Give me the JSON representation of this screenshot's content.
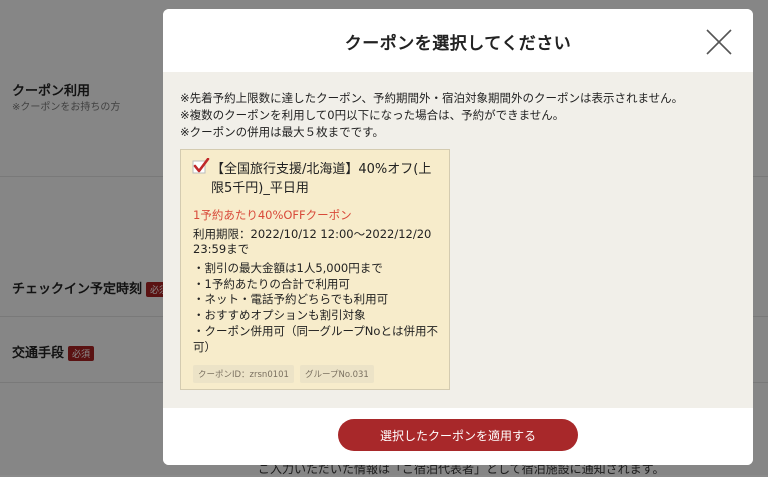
{
  "background": {
    "coupon_label": "クーポン利用",
    "coupon_sub": "※クーポンをお持ちの方",
    "checkin_label": "チェックイン予定時刻",
    "transport_label": "交通手段",
    "required_badge": "必須",
    "bottom_text": "ご入力いただいた情報は「ご宿泊代表者」として宿泊施設に通知されます。"
  },
  "modal": {
    "title": "クーポンを選択してください",
    "close_icon": "close-x-icon",
    "notes": [
      "※先着予約上限数に達したクーポン、予約期間外・宿泊対象期間外のクーポンは表示されません。",
      "※複数のクーポンを利用して0円以下になった場合は、予約ができません。",
      "※クーポンの併用は最大５枚までです。"
    ],
    "coupon": {
      "checked": true,
      "check_icon": "checkmark-icon",
      "check_color": "#c0282a",
      "title": "【全国旅行支援/北海道】40%オフ(上限5千円)_平日用",
      "highlight": "1予約あたり40%OFFクーポン",
      "period": "利用期限：2022/10/12 12:00〜2022/12/20 23:59まで",
      "features": [
        "・割引の最大金額は1人5,000円まで",
        "・1予約あたりの合計で利用可",
        "・ネット・電話予約どちらでも利用可",
        "・おすすめオプションも割引対象",
        "・クーポン併用可（同一グループNoとは併用不可）"
      ],
      "coupon_id": "クーポンID：zrsn0101",
      "group_no": "グループNo.031"
    },
    "apply_button": "選択したクーポンを適用する"
  },
  "colors": {
    "accent": "#a8282a",
    "highlight_text": "#d84a3a",
    "card_bg": "#f7eccb"
  }
}
